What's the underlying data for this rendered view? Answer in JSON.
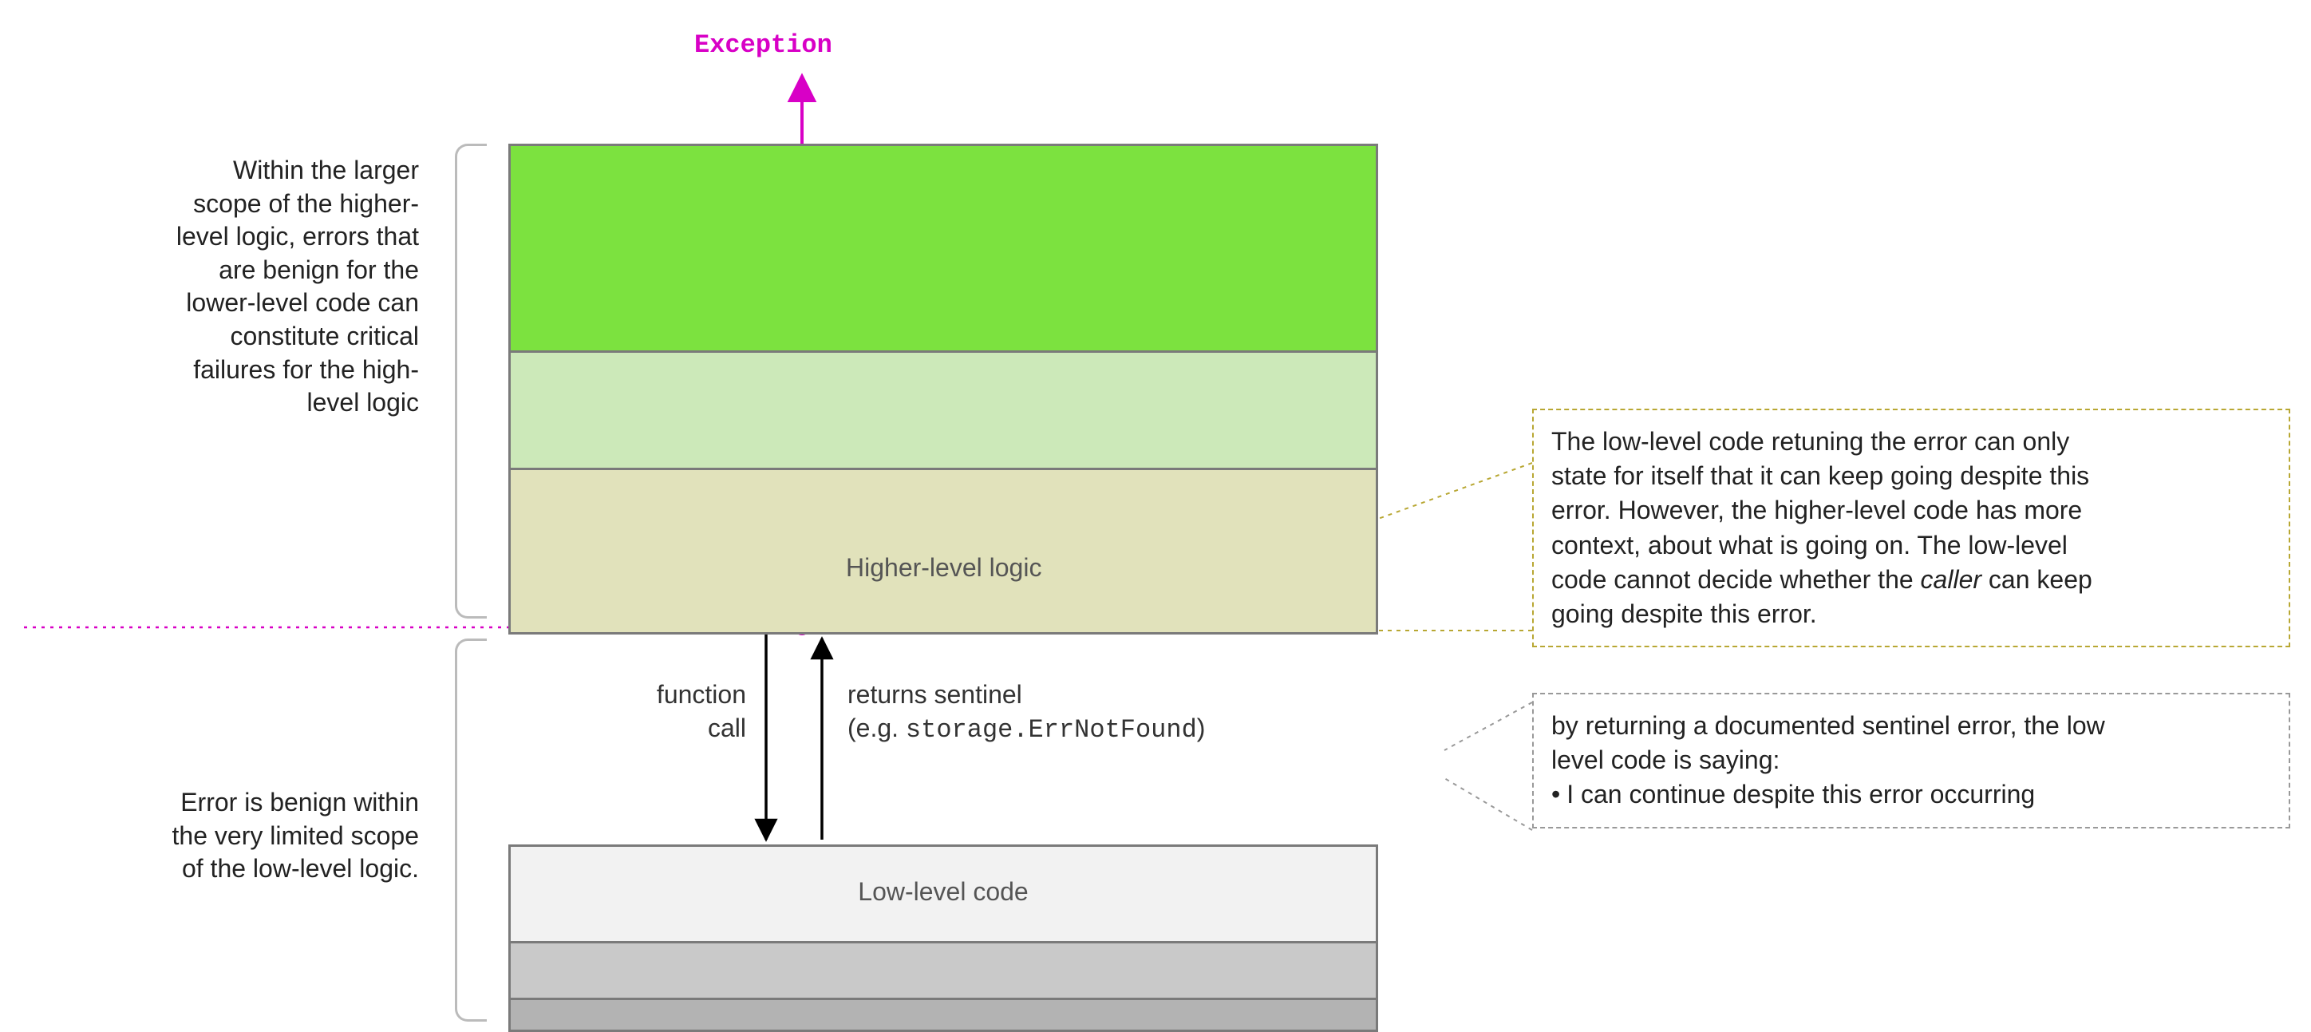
{
  "title_exception": "Exception",
  "higher_block": {
    "label": "Higher-level logic"
  },
  "lower_block": {
    "label": "Low-level code"
  },
  "arrows": {
    "function_call_l1": "function",
    "function_call_l2": "call",
    "returns_sentinel_l1": "returns sentinel",
    "returns_sentinel_l2_prefix": "(e.g. ",
    "returns_sentinel_l2_code": "storage.ErrNotFound",
    "returns_sentinel_l2_suffix": ")"
  },
  "anno_left": {
    "high": {
      "l1": "Within the larger",
      "l2": "scope of the higher-",
      "l3": "level logic, errors that",
      "l4": "are benign for the",
      "l5": "lower-level code can",
      "l6": "constitute critical",
      "l7": "failures for the high-",
      "l8": "level logic"
    },
    "low": {
      "l1": "Error is benign within",
      "l2": "the very limited scope",
      "l3": "of the low-level logic."
    }
  },
  "note_yellow": {
    "l1": "The low-level code retuning the error can only",
    "l2": "state for itself that it can keep going despite this",
    "l3": "error. However, the higher-level code has more",
    "l4": "context, about what is going on. The low-level",
    "l5_prefix": "code cannot decide whether the ",
    "l5_em": "caller",
    "l5_suffix": " can keep",
    "l6": "going despite this error."
  },
  "note_gray": {
    "l1": "by returning a documented sentinel error, the low",
    "l2": "level code is saying:",
    "l3_text": "I can continue despite this error occurring"
  },
  "colors": {
    "green_top": "#7ce23f",
    "green_mid": "#cce9b9",
    "green_bot": "#e1e2bb",
    "gray_light": "#f2f2f2",
    "gray_mid": "#c9c9c9",
    "gray_dark": "#b3b3b3",
    "magenta": "#d800c6"
  }
}
